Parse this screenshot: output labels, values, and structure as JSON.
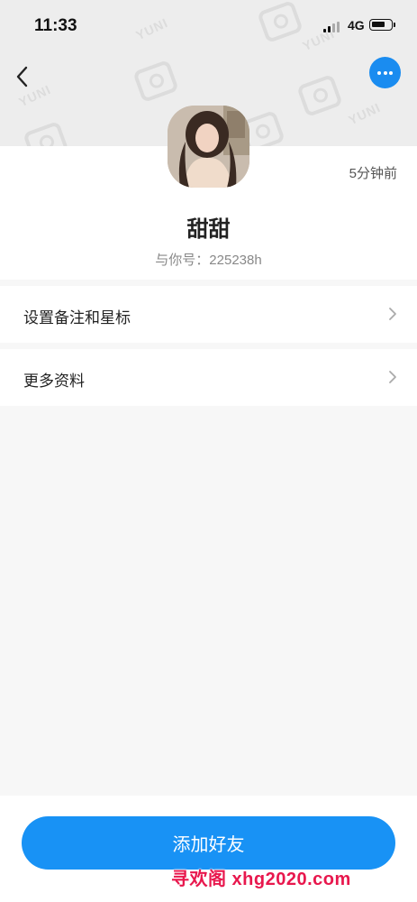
{
  "status_bar": {
    "time": "11:33",
    "network": "4G"
  },
  "header": {
    "pattern_text": "YUNI",
    "back_icon": "chevron-left-icon",
    "more_icon": "ellipsis-icon",
    "accent_color": "#1a8cf0"
  },
  "profile": {
    "last_seen": "5分钟前",
    "nickname": "甜甜",
    "friend_days": "与你号：225238h"
  },
  "menu": {
    "items": [
      {
        "label": "设置备注和星标",
        "icon": "chevron-right-icon"
      },
      {
        "label": "更多资料",
        "icon": "chevron-right-icon"
      }
    ]
  },
  "actions": {
    "add_friend_label": "添加好友"
  },
  "watermark": {
    "text": "寻欢阁 xhg2020.com",
    "color": "#e8174d"
  }
}
